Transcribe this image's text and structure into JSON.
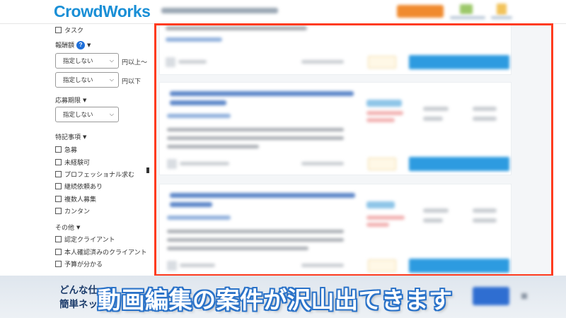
{
  "header": {
    "logo": "CrowdWorks"
  },
  "sidebar": {
    "task_label": "タスク",
    "reward_section": "報酬額",
    "help_icon": "?",
    "reward_min_select": "指定しない",
    "reward_min_unit": "円以上〜",
    "reward_max_select": "指定しない",
    "reward_max_unit": "円以下",
    "deadline_section": "応募期限",
    "deadline_select": "指定しない",
    "features_section": "特記事項",
    "features": [
      "急募",
      "未経験可",
      "プロフェッショナル求む",
      "継続依頼あり",
      "複数人募集",
      "カンタン"
    ],
    "others_section": "その他",
    "others": [
      "認定クライアント",
      "本人確認済みのクライアント",
      "予算が分かる"
    ]
  },
  "bottom": {
    "left_text_line1": "どんな仕",
    "left_text_line2": "簡単ネッ",
    "caption": "動画編集の案件が沢山出てきます"
  },
  "colors": {
    "brand_blue": "#1a8fd6",
    "highlight_red": "#ff3b1f",
    "caption_outline": "#2a72c8"
  }
}
